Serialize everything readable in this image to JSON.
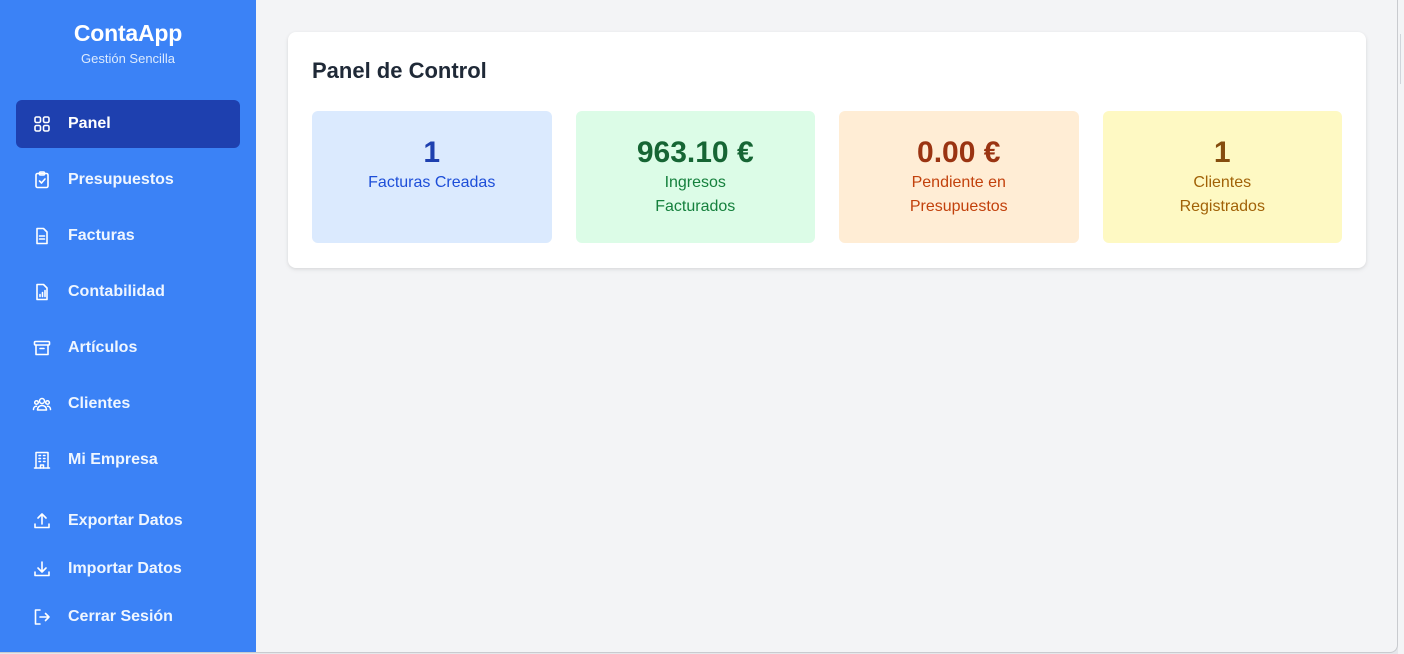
{
  "brand": {
    "title": "ContaApp",
    "subtitle": "Gestión Sencilla"
  },
  "nav": [
    {
      "label": "Panel",
      "icon": "grid-icon",
      "active": true
    },
    {
      "label": "Presupuestos",
      "icon": "clipboard-check-icon"
    },
    {
      "label": "Facturas",
      "icon": "document-icon"
    },
    {
      "label": "Contabilidad",
      "icon": "chart-document-icon"
    },
    {
      "label": "Artículos",
      "icon": "archive-box-icon"
    },
    {
      "label": "Clientes",
      "icon": "users-icon"
    },
    {
      "label": "Mi Empresa",
      "icon": "building-icon"
    }
  ],
  "nav_bottom": [
    {
      "label": "Exportar Datos",
      "icon": "upload-icon"
    },
    {
      "label": "Importar Datos",
      "icon": "download-icon"
    },
    {
      "label": "Cerrar Sesión",
      "icon": "logout-icon"
    }
  ],
  "dashboard": {
    "title": "Panel de Control",
    "stats": [
      {
        "value": "1",
        "label": "Facturas Creadas",
        "color": "#1e40af"
      },
      {
        "value": "963.10 €",
        "label": "Ingresos Facturados",
        "color": "#166534"
      },
      {
        "value": "0.00 €",
        "label": "Pendiente en Presupuestos",
        "color": "#9a3412"
      },
      {
        "value": "1",
        "label": "Clientes Registrados",
        "color": "#854d0e"
      }
    ]
  },
  "colors": {
    "sidebar": "#3b82f6",
    "active_item": "#1e40af",
    "background": "#f3f4f6"
  }
}
